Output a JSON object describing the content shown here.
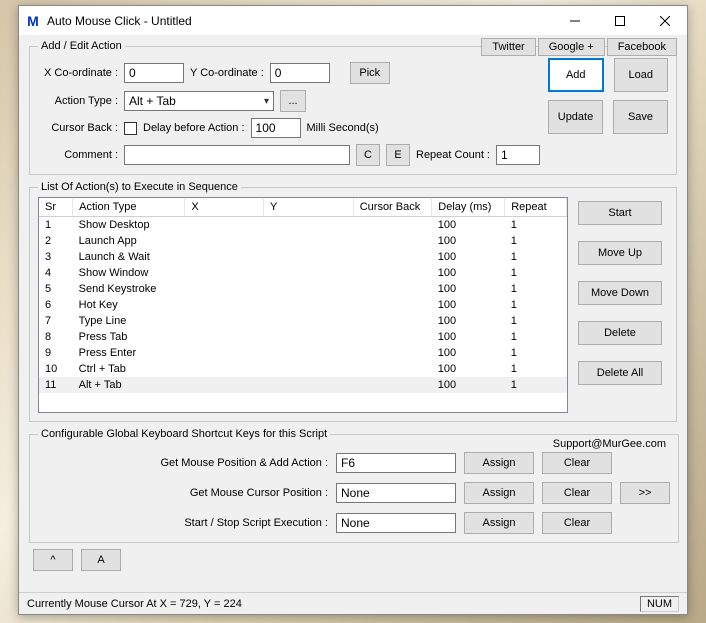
{
  "window": {
    "title": "Auto Mouse Click - Untitled",
    "icon_letter": "M"
  },
  "toplinks": {
    "twitter": "Twitter",
    "google": "Google +",
    "facebook": "Facebook"
  },
  "edit": {
    "legend": "Add / Edit Action",
    "x_label": "X Co-ordinate :",
    "x_value": "0",
    "y_label": "Y Co-ordinate :",
    "y_value": "0",
    "pick": "Pick",
    "action_type_label": "Action Type :",
    "action_type_value": "Alt + Tab",
    "more": "...",
    "cursor_back_label": "Cursor Back :",
    "delay_label": "Delay before Action :",
    "delay_value": "100",
    "delay_unit": "Milli Second(s)",
    "comment_label": "Comment :",
    "comment_value": "",
    "c_btn": "C",
    "e_btn": "E",
    "repeat_label": "Repeat Count :",
    "repeat_value": "1",
    "add": "Add",
    "load": "Load",
    "update": "Update",
    "save": "Save"
  },
  "list": {
    "legend": "List Of Action(s) to Execute in Sequence",
    "headers": {
      "sr": "Sr",
      "at": "Action Type",
      "x": "X",
      "y": "Y",
      "cb": "Cursor Back",
      "d": "Delay (ms)",
      "r": "Repeat"
    },
    "rows": [
      {
        "sr": "1",
        "at": "Show Desktop",
        "x": "",
        "y": "",
        "cb": "",
        "d": "100",
        "r": "1"
      },
      {
        "sr": "2",
        "at": "Launch App",
        "x": "",
        "y": "",
        "cb": "",
        "d": "100",
        "r": "1"
      },
      {
        "sr": "3",
        "at": "Launch & Wait",
        "x": "",
        "y": "",
        "cb": "",
        "d": "100",
        "r": "1"
      },
      {
        "sr": "4",
        "at": "Show Window",
        "x": "",
        "y": "",
        "cb": "",
        "d": "100",
        "r": "1"
      },
      {
        "sr": "5",
        "at": "Send Keystroke",
        "x": "",
        "y": "",
        "cb": "",
        "d": "100",
        "r": "1"
      },
      {
        "sr": "6",
        "at": "Hot Key",
        "x": "",
        "y": "",
        "cb": "",
        "d": "100",
        "r": "1"
      },
      {
        "sr": "7",
        "at": "Type Line",
        "x": "",
        "y": "",
        "cb": "",
        "d": "100",
        "r": "1"
      },
      {
        "sr": "8",
        "at": "Press Tab",
        "x": "",
        "y": "",
        "cb": "",
        "d": "100",
        "r": "1"
      },
      {
        "sr": "9",
        "at": "Press Enter",
        "x": "",
        "y": "",
        "cb": "",
        "d": "100",
        "r": "1"
      },
      {
        "sr": "10",
        "at": "Ctrl + Tab",
        "x": "",
        "y": "",
        "cb": "",
        "d": "100",
        "r": "1"
      },
      {
        "sr": "11",
        "at": "Alt + Tab",
        "x": "",
        "y": "",
        "cb": "",
        "d": "100",
        "r": "1"
      }
    ],
    "buttons": {
      "start": "Start",
      "moveup": "Move Up",
      "movedown": "Move Down",
      "delete": "Delete",
      "deleteall": "Delete All"
    }
  },
  "shortcuts": {
    "legend": "Configurable Global Keyboard Shortcut Keys for this Script",
    "support": "Support@MurGee.com",
    "row1_label": "Get Mouse Position & Add Action :",
    "row1_value": "F6",
    "row2_label": "Get Mouse Cursor Position :",
    "row2_value": "None",
    "row3_label": "Start / Stop Script Execution :",
    "row3_value": "None",
    "assign": "Assign",
    "clear": "Clear",
    "more": ">>"
  },
  "bottom": {
    "caret": "^",
    "a": "A"
  },
  "status": {
    "text": "Currently Mouse Cursor At X = 729, Y = 224",
    "num": "NUM"
  }
}
